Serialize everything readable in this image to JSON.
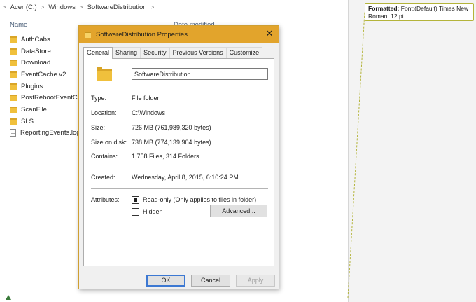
{
  "breadcrumb": {
    "chevron": ">",
    "items": [
      "Acer (C:)",
      "Windows",
      "SoftwareDistribution"
    ]
  },
  "explorer": {
    "column_name": "Name",
    "column_date_partial": "Date modified",
    "files": [
      {
        "name": "AuthCabs",
        "type": "folder"
      },
      {
        "name": "DataStore",
        "type": "folder"
      },
      {
        "name": "Download",
        "type": "folder"
      },
      {
        "name": "EventCache.v2",
        "type": "folder"
      },
      {
        "name": "Plugins",
        "type": "folder"
      },
      {
        "name": "PostRebootEventCa",
        "type": "folder"
      },
      {
        "name": "ScanFile",
        "type": "folder"
      },
      {
        "name": "SLS",
        "type": "folder"
      },
      {
        "name": "ReportingEvents.log",
        "type": "file"
      }
    ]
  },
  "comment": {
    "label": "Formatted:",
    "text": "Font:(Default) Times New Roman, 12 pt"
  },
  "dialog": {
    "title": "SoftwareDistribution Properties",
    "close_glyph": "✕",
    "tabs": [
      "General",
      "Sharing",
      "Security",
      "Previous Versions",
      "Customize"
    ],
    "active_tab": "General",
    "name_value": "SoftwareDistribution",
    "props": {
      "type_label": "Type:",
      "type_value": "File folder",
      "location_label": "Location:",
      "location_value": "C:\\Windows",
      "size_label": "Size:",
      "size_value": "726 MB (761,989,320 bytes)",
      "size_disk_label": "Size on disk:",
      "size_disk_value": "738 MB (774,139,904 bytes)",
      "contains_label": "Contains:",
      "contains_value": "1,758 Files, 314 Folders",
      "created_label": "Created:",
      "created_value": "Wednesday, April 8, 2015, 6:10:24 PM",
      "attributes_label": "Attributes:",
      "readonly_label": "Read-only (Only applies to files in folder)",
      "hidden_label": "Hidden",
      "advanced_label": "Advanced..."
    },
    "buttons": {
      "ok": "OK",
      "cancel": "Cancel",
      "apply": "Apply"
    }
  },
  "colors": {
    "titlebar": "#e2a42c",
    "folder": "#f0c03c",
    "track_change": "#b4b43a"
  }
}
